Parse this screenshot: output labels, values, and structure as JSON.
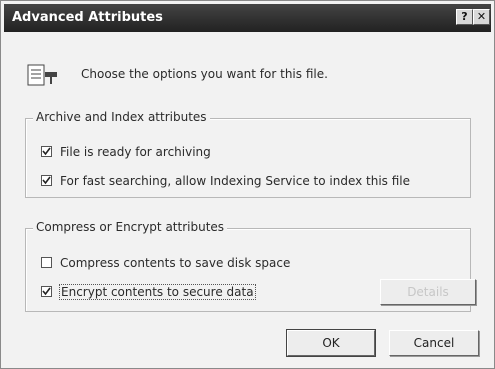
{
  "window": {
    "title": "Advanced Attributes",
    "help_glyph": "?",
    "close_glyph": "✕"
  },
  "header": {
    "text": "Choose the options you want for this file."
  },
  "archive_group": {
    "legend": "Archive and Index attributes",
    "options": [
      {
        "label": "File is ready for archiving",
        "checked": true
      },
      {
        "label": "For fast searching, allow Indexing Service to index this file",
        "checked": true
      }
    ]
  },
  "compress_group": {
    "legend": "Compress or Encrypt attributes",
    "options": [
      {
        "label": "Compress contents to save disk space",
        "checked": false
      },
      {
        "label": "Encrypt contents to secure data",
        "checked": true
      }
    ],
    "details_label": "Details"
  },
  "buttons": {
    "ok": "OK",
    "cancel": "Cancel"
  }
}
